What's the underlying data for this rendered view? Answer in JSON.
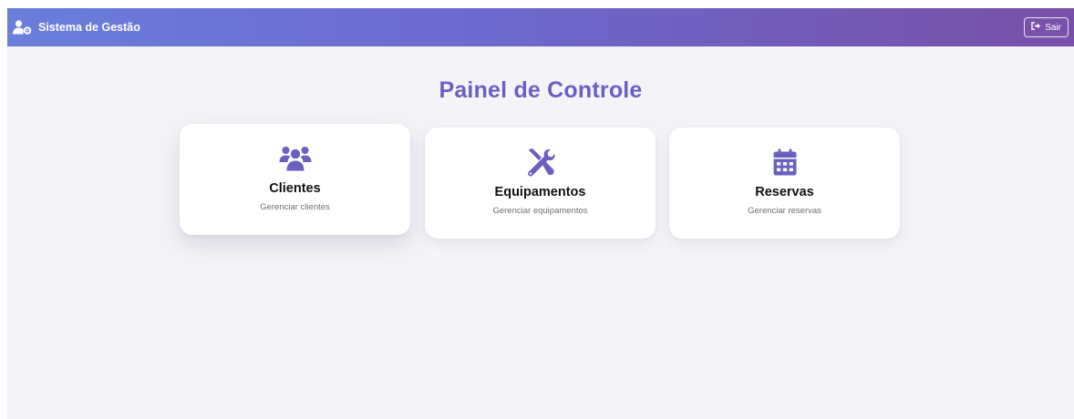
{
  "app": {
    "brand_title": "Sistema de Gestão",
    "logout_label": "Sair"
  },
  "page": {
    "title": "Painel de Controle"
  },
  "cards": [
    {
      "icon": "users-icon",
      "title": "Clientes",
      "description": "Gerenciar clientes"
    },
    {
      "icon": "tools-icon",
      "title": "Equipamentos",
      "description": "Gerenciar equipamentos"
    },
    {
      "icon": "calendar-icon",
      "title": "Reservas",
      "description": "Gerenciar reservas"
    }
  ],
  "colors": {
    "accent": "#6b5fc2",
    "navbar_start": "#6a7edb",
    "navbar_end": "#7a4fa9",
    "background": "#f4f4f8"
  }
}
